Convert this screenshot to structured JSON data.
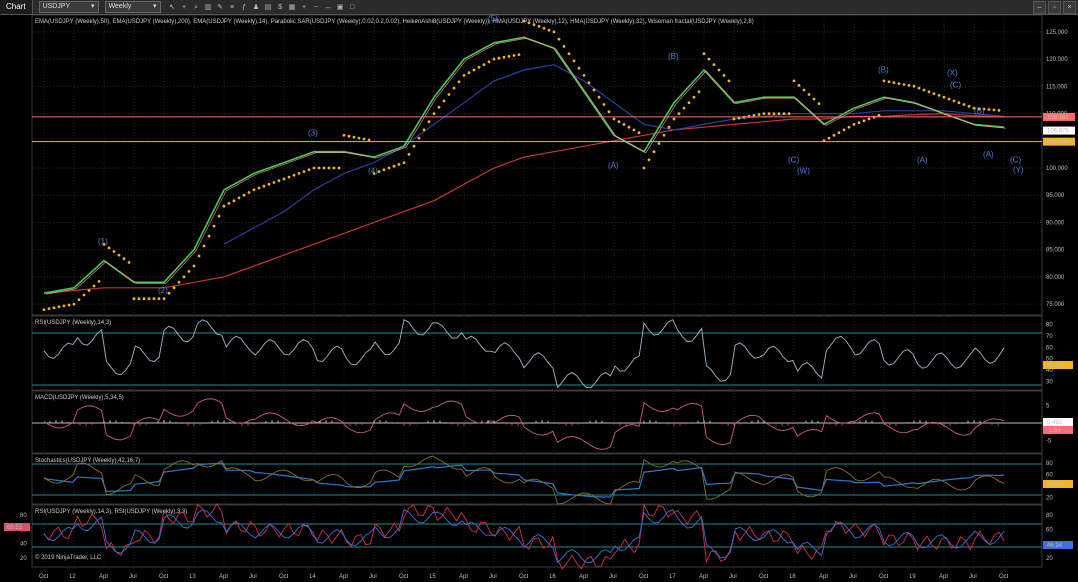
{
  "toolbar": {
    "title": "Chart",
    "instrument": "USDJPY",
    "interval": "Weekly",
    "icons": [
      "cursor-icon",
      "crosshair-icon",
      "zoom-icon",
      "bar-style-icon",
      "draw-icon",
      "properties-icon",
      "indicators-icon",
      "strategy-icon",
      "template-icon",
      "chart-trader-icon",
      "data-box-icon",
      "plus-icon",
      "minus-icon",
      "scroll-icon",
      "lock-icon",
      "window-icon"
    ],
    "window_buttons": [
      "minimize-icon",
      "restore-icon",
      "close-icon"
    ]
  },
  "price_panel": {
    "indicator_title": "EMA(USDJPY (Weekly),50), EMA(USDJPY (Weekly),200), EMA(USDJPY (Weekly),14), Parabolic SAR(USDJPY (Weekly),0.02,0.2,0.02), HeikenAshi8(USDJPY (Weekly)), HMA(USDJPY (Weekly),12), HMA(USDJPY (Weekly),32), Wiseman fractal(USDJPY (Weekly),2,8)",
    "y_ticks": [
      "125.000",
      "120.000",
      "115.000",
      "110.000",
      "105.000",
      "100.000",
      "95.000",
      "90.000",
      "85.000",
      "80.000",
      "75.000"
    ],
    "markers": [
      {
        "label": "109.382",
        "color": "#ff6b6b",
        "text_color": "#000000"
      },
      {
        "label": "106.875",
        "color": "#ffffff",
        "text_color": "#000000"
      },
      {
        "label": "104.840",
        "color": "#f0b429",
        "text_color": "#000000"
      }
    ],
    "wave_labels": [
      "(1)",
      "(2)",
      "(3)",
      "(4)",
      "(5)",
      "(A)",
      "(B)",
      "(C)",
      "(W)",
      "(B)",
      "(A)",
      "(X)",
      "(C)",
      "(B)",
      "(A)",
      "(C)",
      "(Y)"
    ]
  },
  "rsi_panel": {
    "title": "RSI(USDJPY (Weekly),14,3)",
    "y_ticks": [
      "80",
      "70",
      "60",
      "50",
      "40",
      "30"
    ],
    "value": "46.94",
    "color": "#7fb3d5"
  },
  "macd_panel": {
    "title": "MACD(USDJPY (Weekly),5,34,5)",
    "y_ticks": [
      "5",
      "0",
      "-5"
    ],
    "values": [
      "0.492",
      "-1.51"
    ]
  },
  "stoch_panel": {
    "title": "Stochastics(USDJPY (Weekly),42,16,7)",
    "y_ticks": [
      "80",
      "60",
      "40",
      "20"
    ],
    "value": "41.64"
  },
  "rsi2_panel": {
    "title": "RSI(USDJPY (Weekly),14,3), RSI(USDJPY (Weekly),3,3)",
    "y_ticks": [
      "80",
      "60",
      "40",
      "20"
    ],
    "left_ticks": [
      "80",
      "60",
      "40",
      "20"
    ],
    "left_value": "65.53",
    "value": "46.94",
    "copyright": "© 2019 NinjaTrader, LLC"
  },
  "x_axis": [
    "Oct",
    "12",
    "Apr",
    "Jul",
    "Oct",
    "13",
    "Apr",
    "Jul",
    "Oct",
    "14",
    "Apr",
    "Jul",
    "Oct",
    "15",
    "Apr",
    "Jul",
    "Oct",
    "16",
    "Apr",
    "Jul",
    "Oct",
    "17",
    "Apr",
    "Jul",
    "Oct",
    "18",
    "Apr",
    "Jul",
    "Oct",
    "19",
    "Apr",
    "Jul",
    "Oct"
  ],
  "chart_data": {
    "type": "line",
    "title": "",
    "instrument": "USDJPY",
    "interval": "Weekly",
    "x": [
      "Oct",
      "12",
      "Apr",
      "Jul",
      "Oct",
      "13",
      "Apr",
      "Jul",
      "Oct",
      "14",
      "Apr",
      "Jul",
      "Oct",
      "15",
      "Apr",
      "Jul",
      "Oct",
      "16",
      "Apr",
      "Jul",
      "Oct",
      "17",
      "Apr",
      "Jul",
      "Oct",
      "18",
      "Apr",
      "Jul",
      "Oct",
      "19",
      "Apr",
      "Jul",
      "Oct"
    ],
    "ylim": [
      73,
      127
    ],
    "series": [
      {
        "name": "EMA(USDJPY (Weekly),200)",
        "color": "#c0392b",
        "values": [
          77,
          77.5,
          78,
          78,
          78,
          79,
          80,
          82,
          84,
          86,
          88,
          90,
          92,
          94,
          97,
          100,
          102,
          103,
          104,
          105,
          106,
          107,
          107.5,
          108,
          108.5,
          109,
          109,
          109.5,
          109.5,
          109.8,
          110,
          109.6,
          109.4
        ]
      },
      {
        "name": "EMA(USDJPY (Weekly),50)",
        "color": "#2c3e9f",
        "values": [
          null,
          null,
          null,
          null,
          null,
          null,
          86,
          89,
          92,
          96,
          99,
          101,
          104,
          108,
          112,
          116,
          118,
          119,
          116,
          112,
          108,
          107,
          108,
          109,
          109.5,
          110,
          110,
          110,
          110.5,
          110.5,
          110.5,
          110,
          109.5
        ]
      }
    ],
    "price_path": [
      77,
      78,
      83,
      79,
      79,
      85,
      96,
      99,
      101,
      103,
      103,
      102,
      104,
      113,
      120,
      123,
      124,
      122,
      114,
      106,
      103,
      112,
      118,
      112,
      113,
      113,
      108,
      111,
      113,
      112,
      110,
      108,
      107.5
    ],
    "horizontal_lines": [
      109.382,
      104.84
    ],
    "last_price": 106.875
  }
}
